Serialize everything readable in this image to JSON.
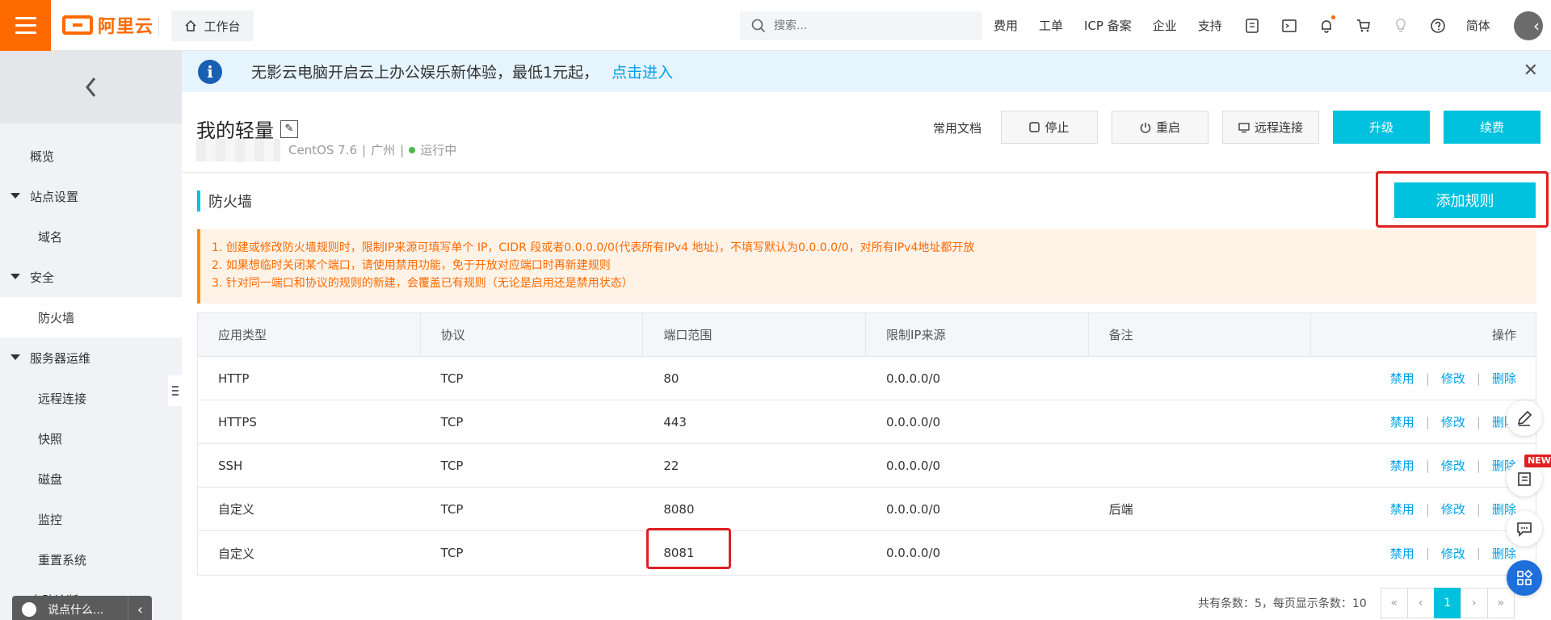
{
  "topbar": {
    "logo_text": "阿里云",
    "workbench_label": "工作台",
    "search_placeholder": "搜索...",
    "nav": [
      "费用",
      "工单",
      "ICP 备案",
      "企业",
      "支持"
    ],
    "lang": "简体",
    "accent_color": "#ff6a00"
  },
  "sidebar": {
    "items": [
      {
        "label": "概览"
      },
      {
        "label": "站点设置"
      },
      {
        "label": "域名"
      },
      {
        "label": "安全"
      },
      {
        "label": "防火墙"
      },
      {
        "label": "服务器运维"
      },
      {
        "label": "远程连接"
      },
      {
        "label": "快照"
      },
      {
        "label": "磁盘"
      },
      {
        "label": "监控"
      },
      {
        "label": "重置系统"
      },
      {
        "label": "自助诊断"
      }
    ],
    "chat_placeholder": "说点什么..."
  },
  "notice": {
    "text": "无影云电脑开启云上办公娱乐新体验，最低1元起，",
    "link": "点击进入"
  },
  "header": {
    "title": "我的轻量",
    "os": "CentOS 7.6",
    "region": "广州",
    "status": "运行中",
    "docs": "常用文档",
    "stop": "停止",
    "restart": "重启",
    "remote": "远程连接",
    "upgrade": "升级",
    "renew": "续费"
  },
  "firewall": {
    "title": "防火墙",
    "add_rule": "添加规则",
    "tips": [
      "1. 创建或修改防火墙规则时，限制IP来源可填写单个 IP，CIDR 段或者0.0.0.0/0(代表所有IPv4 地址)，不填写默认为0.0.0.0/0，对所有IPv4地址都开放",
      "2. 如果想临时关闭某个端口，请使用禁用功能，免于开放对应端口时再新建规则",
      "3. 针对同一端口和协议的规则的新建，会覆盖已有规则（无论是启用还是禁用状态）"
    ],
    "columns": [
      "应用类型",
      "协议",
      "端口范围",
      "限制IP来源",
      "备注",
      "操作"
    ],
    "rows": [
      {
        "app": "HTTP",
        "protocol": "TCP",
        "port": "80",
        "source": "0.0.0.0/0",
        "note": ""
      },
      {
        "app": "HTTPS",
        "protocol": "TCP",
        "port": "443",
        "source": "0.0.0.0/0",
        "note": ""
      },
      {
        "app": "SSH",
        "protocol": "TCP",
        "port": "22",
        "source": "0.0.0.0/0",
        "note": ""
      },
      {
        "app": "自定义",
        "protocol": "TCP",
        "port": "8080",
        "source": "0.0.0.0/0",
        "note": "后端"
      },
      {
        "app": "自定义",
        "protocol": "TCP",
        "port": "8081",
        "source": "0.0.0.0/0",
        "note": ""
      }
    ],
    "ops": {
      "disable": "禁用",
      "modify": "修改",
      "delete": "删除"
    },
    "pager_text": "共有条数：5，每页显示条数：10",
    "current_page": "1"
  },
  "new_badge": "NEW"
}
